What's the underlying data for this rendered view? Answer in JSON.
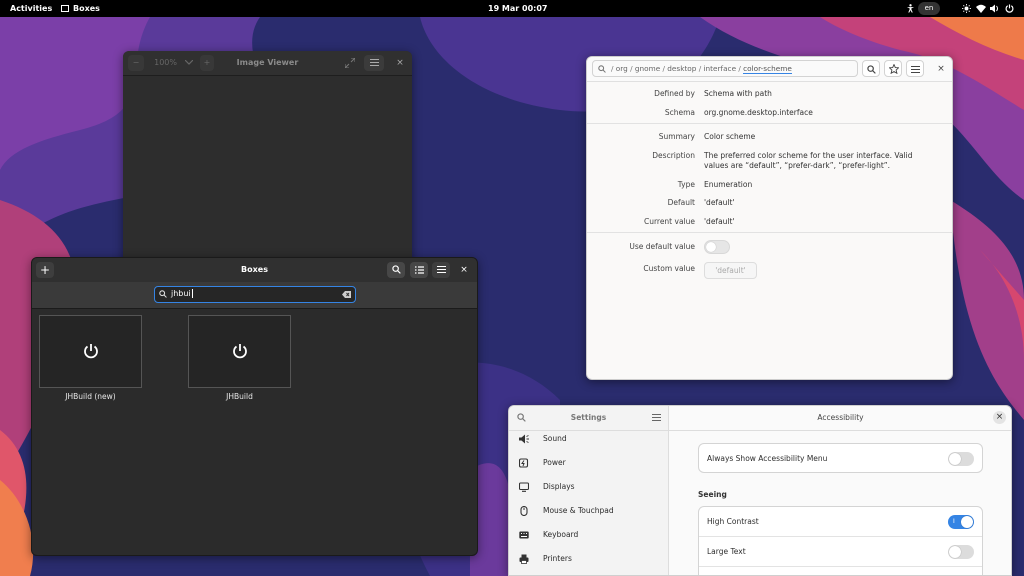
{
  "topbar": {
    "activities": "Activities",
    "app_name": "Boxes",
    "clock": "19 Mar  00:07",
    "language": "en",
    "icons": [
      "accessibility-icon",
      "brightness-icon",
      "wifi-icon",
      "volume-icon",
      "power-icon"
    ]
  },
  "image_viewer": {
    "title": "Image Viewer",
    "zoom": "100%"
  },
  "boxes": {
    "title": "Boxes",
    "search_value": "jhbui",
    "machines": [
      {
        "name": "JHBuild (new)"
      },
      {
        "name": "JHBuild"
      }
    ]
  },
  "dconf": {
    "path_segments": [
      "org",
      "gnome",
      "desktop",
      "interface",
      "color-scheme"
    ],
    "defined_by_label": "Defined by",
    "defined_by_value": "Schema with path",
    "schema_label": "Schema",
    "schema_value": "org.gnome.desktop.interface",
    "summary_label": "Summary",
    "summary_value": "Color scheme",
    "description_label": "Description",
    "description_value": "The preferred color scheme for the user interface. Valid values are “default”, “prefer-dark”, “prefer-light”.",
    "type_label": "Type",
    "type_value": "Enumeration",
    "default_label": "Default",
    "default_value": "'default'",
    "current_label": "Current value",
    "current_value": "'default'",
    "use_default_label": "Use default value",
    "use_default_on": false,
    "custom_label": "Custom value",
    "custom_value": "'default'"
  },
  "settings": {
    "sidebar_title": "Settings",
    "page_title": "Accessibility",
    "nav": [
      {
        "label": "Sound",
        "icon": "speaker-icon"
      },
      {
        "label": "Power",
        "icon": "power-plug-icon"
      },
      {
        "label": "Displays",
        "icon": "monitor-icon"
      },
      {
        "label": "Mouse & Touchpad",
        "icon": "mouse-icon"
      },
      {
        "label": "Keyboard",
        "icon": "keyboard-icon"
      },
      {
        "label": "Printers",
        "icon": "printer-icon"
      }
    ],
    "always_show_menu": {
      "label": "Always Show Accessibility Menu",
      "on": false
    },
    "seeing_heading": "Seeing",
    "high_contrast": {
      "label": "High Contrast",
      "on": true
    },
    "large_text": {
      "label": "Large Text",
      "on": false
    }
  },
  "colors": {
    "accent": "#3584e4",
    "topbar": "#000000",
    "dark_window": "#2b2b2b",
    "light_window": "#fafafa"
  }
}
